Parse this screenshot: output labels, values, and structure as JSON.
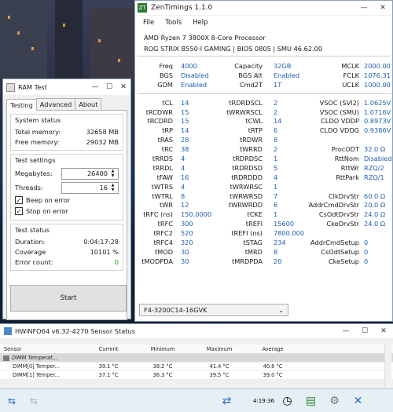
{
  "zentimings": {
    "title": "ZenTimings 1.1.0",
    "logo_text": "ZT",
    "menu": [
      "File",
      "Tools",
      "Help"
    ],
    "cpu": "AMD Ryzen 7 3800X 8-Core Processor",
    "board": "ROG STRIX B550-I GAMING | BIOS 0805 | SMU 46.62.00",
    "top_rows": [
      {
        "l1": "Freq",
        "v1": "4000",
        "l2": "Capacity",
        "v2": "32GB",
        "l3": "MCLK",
        "v3": "2000.00"
      },
      {
        "l1": "BGS",
        "v1": "Disabled",
        "l2": "BGS Alt",
        "v2": "Enabled",
        "l3": "FCLK",
        "v3": "1076.31"
      },
      {
        "l1": "GDM",
        "v1": "Enabled",
        "l2": "Cmd2T",
        "v2": "1T",
        "l3": "UCLK",
        "v3": "1000.00"
      }
    ],
    "timing_rows": [
      {
        "l1": "tCL",
        "v1": "14",
        "l2": "tRDRDSCL",
        "v2": "2",
        "l3": "VSOC (SVI2)",
        "v3": "1.0625V"
      },
      {
        "l1": "tRCDWR",
        "v1": "15",
        "l2": "tWRWRSCL",
        "v2": "2",
        "l3": "VSOC (SMU)",
        "v3": "1.0716V"
      },
      {
        "l1": "tRCDRD",
        "v1": "15",
        "l2": "tCWL",
        "v2": "14",
        "l3": "CLDO VDDP",
        "v3": "0.8973V"
      },
      {
        "l1": "tRP",
        "v1": "14",
        "l2": "tRTP",
        "v2": "6",
        "l3": "CLDO VDDG",
        "v3": "0.9386V"
      },
      {
        "l1": "tRAS",
        "v1": "28",
        "l2": "tRDWR",
        "v2": "8",
        "l3": "",
        "v3": ""
      },
      {
        "l1": "tRC",
        "v1": "38",
        "l2": "tWRRD",
        "v2": "2",
        "l3": "ProcODT",
        "v3": "32.0 Ω"
      },
      {
        "l1": "tRRDS",
        "v1": "4",
        "l2": "tRDRDSC",
        "v2": "1",
        "l3": "RttNom",
        "v3": "Disabled"
      },
      {
        "l1": "tRRDL",
        "v1": "4",
        "l2": "tRDRDSD",
        "v2": "5",
        "l3": "RttWr",
        "v3": "RZQ/2"
      },
      {
        "l1": "tFAW",
        "v1": "16",
        "l2": "tRDRDDD",
        "v2": "4",
        "l3": "RttPark",
        "v3": "RZQ/1"
      },
      {
        "l1": "tWTRS",
        "v1": "4",
        "l2": "tWRWRSC",
        "v2": "1",
        "l3": "",
        "v3": ""
      },
      {
        "l1": "tWTRL",
        "v1": "8",
        "l2": "tWRWRSD",
        "v2": "7",
        "l3": "ClkDrvStr",
        "v3": "60.0 Ω"
      },
      {
        "l1": "tWR",
        "v1": "12",
        "l2": "tWRWRDD",
        "v2": "6",
        "l3": "AddrCmdDrvStr",
        "v3": "20.0 Ω"
      },
      {
        "l1": "tRFC (ns)",
        "v1": "150.0000",
        "l2": "tCKE",
        "v2": "1",
        "l3": "CsOdtDrvStr",
        "v3": "24.0 Ω"
      },
      {
        "l1": "tRFC",
        "v1": "300",
        "l2": "tREFI",
        "v2": "15600",
        "l3": "CkeDrvStr",
        "v3": "24.0 Ω"
      },
      {
        "l1": "tRFC2",
        "v1": "520",
        "l2": "tREFI (ns)",
        "v2": "7800.000",
        "l3": "",
        "v3": ""
      },
      {
        "l1": "tRFC4",
        "v1": "320",
        "l2": "tSTAG",
        "v2": "234",
        "l3": "AddrCmdSetup",
        "v3": "0"
      },
      {
        "l1": "tMOD",
        "v1": "30",
        "l2": "tMRD",
        "v2": "8",
        "l3": "CsOdtSetup",
        "v3": "0"
      },
      {
        "l1": "tMODPDA",
        "v1": "30",
        "l2": "tMRDPDA",
        "v2": "20",
        "l3": "CkeSetup",
        "v3": "0"
      }
    ],
    "profile_select": "F4-3200C14-16GVK"
  },
  "ramtest": {
    "title": "RAM Test",
    "tabs": [
      "Testing",
      "Advanced",
      "About"
    ],
    "system_status_title": "System status",
    "total_memory_label": "Total memory:",
    "total_memory": "32658 MB",
    "free_memory_label": "Free memory:",
    "free_memory": "29032 MB",
    "test_settings_title": "Test settings",
    "megabytes_label": "Megabytes:",
    "megabytes": "26400",
    "threads_label": "Threads:",
    "threads": "16",
    "beep_label": "Beep on error",
    "stop_label": "Stop on error",
    "test_status_title": "Test status",
    "duration_label": "Duration:",
    "duration": "0:04:17:28",
    "coverage_label": "Coverage",
    "coverage": "10101 %",
    "errors_label": "Error count:",
    "errors": "0",
    "start_label": "Start"
  },
  "hwinfo": {
    "title": "HWiNFO64 v6.32-4270 Sensor Status",
    "columns": [
      "Sensor",
      "Current",
      "Minimum",
      "Maximum",
      "Average"
    ],
    "group": "DIMM Temperat...",
    "rows": [
      {
        "sensor": "DIMM[0] Temper...",
        "current": "39.1 °C",
        "minimum": "38.2 °C",
        "maximum": "41.4 °C",
        "average": "40.8 °C"
      },
      {
        "sensor": "DIMM[1] Temper...",
        "current": "37.1 °C",
        "minimum": "36.3 °C",
        "maximum": "39.5 °C",
        "average": "39.0 °C"
      }
    ],
    "timer": "4:19:36"
  },
  "colors": {
    "value_blue": "#1f5fb0",
    "zt_green": "#2e7d32",
    "error_green": "#1a9a1a"
  }
}
